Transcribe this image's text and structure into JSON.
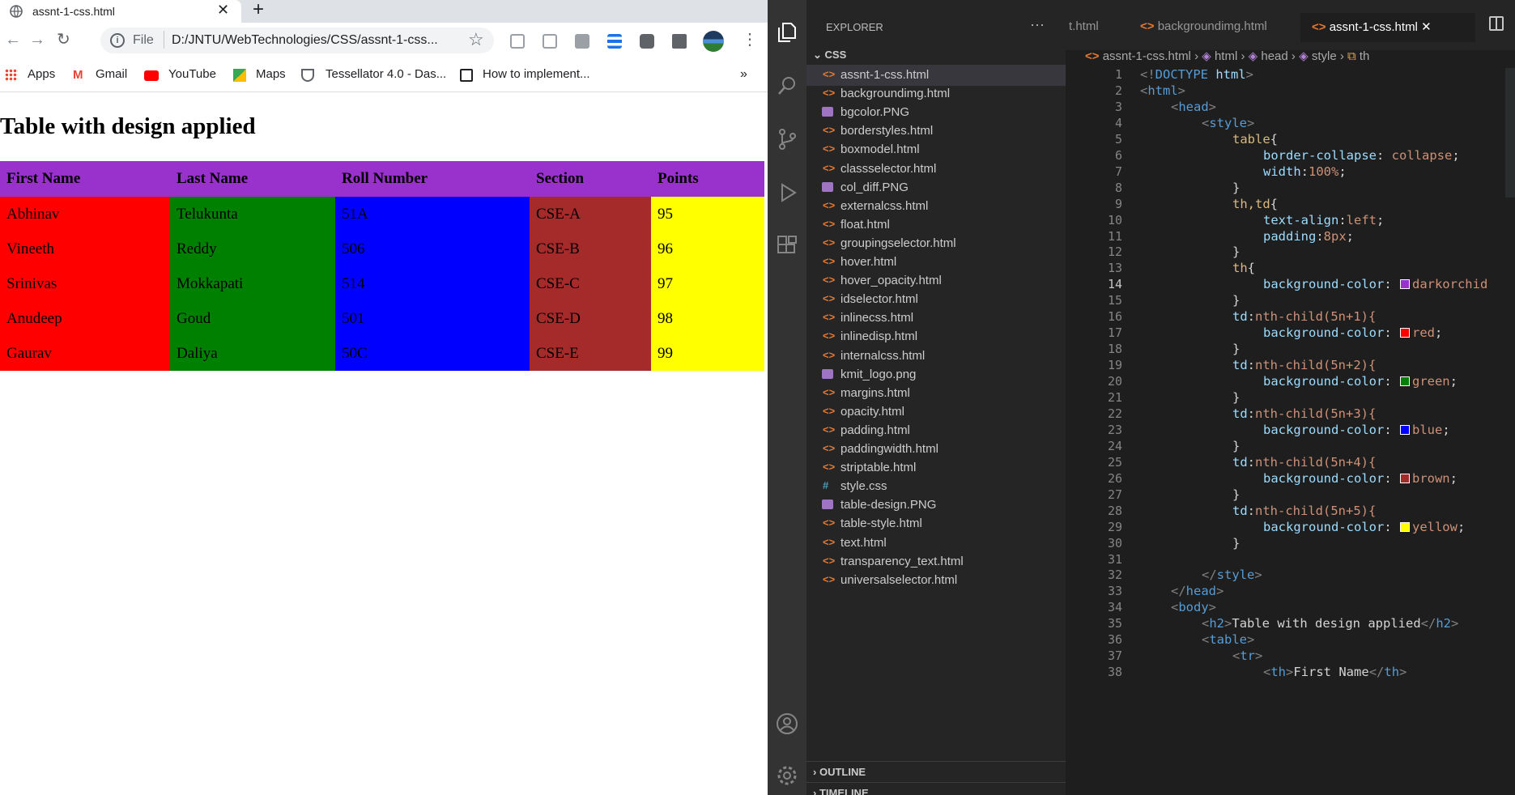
{
  "browser": {
    "tab_title": "assnt-1-css.html",
    "tab_close": "✕",
    "new_tab": "+",
    "nav": {
      "back": "←",
      "forward": "→",
      "reload": "↻"
    },
    "url_scheme": "File",
    "url": "D:/JNTU/WebTechnologies/CSS/assnt-1-css...",
    "bookmarks": [
      "Apps",
      "Gmail",
      "YouTube",
      "Maps",
      "Tessellator 4.0 - Das...",
      "How to implement..."
    ],
    "bookmarks_more": "»",
    "page": {
      "heading": "Table with design applied",
      "table": {
        "headers": [
          "First Name",
          "Last Name",
          "Roll Number",
          "Section",
          "Points"
        ],
        "rows": [
          [
            "Abhinav",
            "Telukunta",
            "51A",
            "CSE-A",
            "95"
          ],
          [
            "Vineeth",
            "Reddy",
            "506",
            "CSE-B",
            "96"
          ],
          [
            "Srinivas",
            "Mokkapati",
            "514",
            "CSE-C",
            "97"
          ],
          [
            "Anudeep",
            "Goud",
            "501",
            "CSE-D",
            "98"
          ],
          [
            "Gaurav",
            "Daliya",
            "50C",
            "CSE-E",
            "99"
          ]
        ]
      }
    }
  },
  "vscode": {
    "explorer": {
      "title": "EXPLORER",
      "more": "···",
      "folder": "CSS",
      "files": [
        {
          "name": "assnt-1-css.html",
          "type": "html",
          "selected": true
        },
        {
          "name": "backgroundimg.html",
          "type": "html"
        },
        {
          "name": "bgcolor.PNG",
          "type": "png"
        },
        {
          "name": "borderstyles.html",
          "type": "html"
        },
        {
          "name": "boxmodel.html",
          "type": "html"
        },
        {
          "name": "classselector.html",
          "type": "html"
        },
        {
          "name": "col_diff.PNG",
          "type": "png"
        },
        {
          "name": "externalcss.html",
          "type": "html"
        },
        {
          "name": "float.html",
          "type": "html"
        },
        {
          "name": "groupingselector.html",
          "type": "html"
        },
        {
          "name": "hover.html",
          "type": "html"
        },
        {
          "name": "hover_opacity.html",
          "type": "html"
        },
        {
          "name": "idselector.html",
          "type": "html"
        },
        {
          "name": "inlinecss.html",
          "type": "html"
        },
        {
          "name": "inlinedisp.html",
          "type": "html"
        },
        {
          "name": "internalcss.html",
          "type": "html"
        },
        {
          "name": "kmit_logo.png",
          "type": "png"
        },
        {
          "name": "margins.html",
          "type": "html"
        },
        {
          "name": "opacity.html",
          "type": "html"
        },
        {
          "name": "padding.html",
          "type": "html"
        },
        {
          "name": "paddingwidth.html",
          "type": "html"
        },
        {
          "name": "striptable.html",
          "type": "html"
        },
        {
          "name": "style.css",
          "type": "css"
        },
        {
          "name": "table-design.PNG",
          "type": "png"
        },
        {
          "name": "table-style.html",
          "type": "html"
        },
        {
          "name": "text.html",
          "type": "html"
        },
        {
          "name": "transparency_text.html",
          "type": "html"
        },
        {
          "name": "universalselector.html",
          "type": "html"
        }
      ],
      "outline": "OUTLINE",
      "timeline": "TIMELINE"
    },
    "tabs": [
      {
        "label": "t.html"
      },
      {
        "label": "backgroundimg.html"
      },
      {
        "label": "assnt-1-css.html",
        "active": true
      }
    ],
    "tab_close": "✕",
    "breadcrumb": [
      "assnt-1-css.html",
      "html",
      "head",
      "style",
      "th"
    ],
    "colors": {
      "darkorchid": "#9932cc",
      "red": "#ff0000",
      "green": "#008000",
      "blue": "#0000ff",
      "brown": "#a52a2a",
      "yellow": "#ffff00"
    },
    "code_lines": [
      "<!DOCTYPE html>",
      "<html>",
      "<head>",
      "<style>",
      "table{",
      "border-collapse: collapse;",
      "width:100%;",
      "}",
      "th,td{",
      "text-align:left;",
      "padding:8px;",
      "}",
      "th{",
      "background-color: darkorchid",
      "}",
      "td:nth-child(5n+1){",
      "background-color: red;",
      "}",
      "td:nth-child(5n+2){",
      "background-color: green;",
      "}",
      "td:nth-child(5n+3){",
      "background-color: blue;",
      "}",
      "td:nth-child(5n+4){",
      "background-color: brown;",
      "}",
      "td:nth-child(5n+5){",
      "background-color: yellow;",
      "}",
      "",
      "</style>",
      "</head>",
      "<body>",
      "<h2>Table with design applied</h2>",
      "<table>",
      "<tr>",
      "<th>First Name</th>"
    ]
  }
}
